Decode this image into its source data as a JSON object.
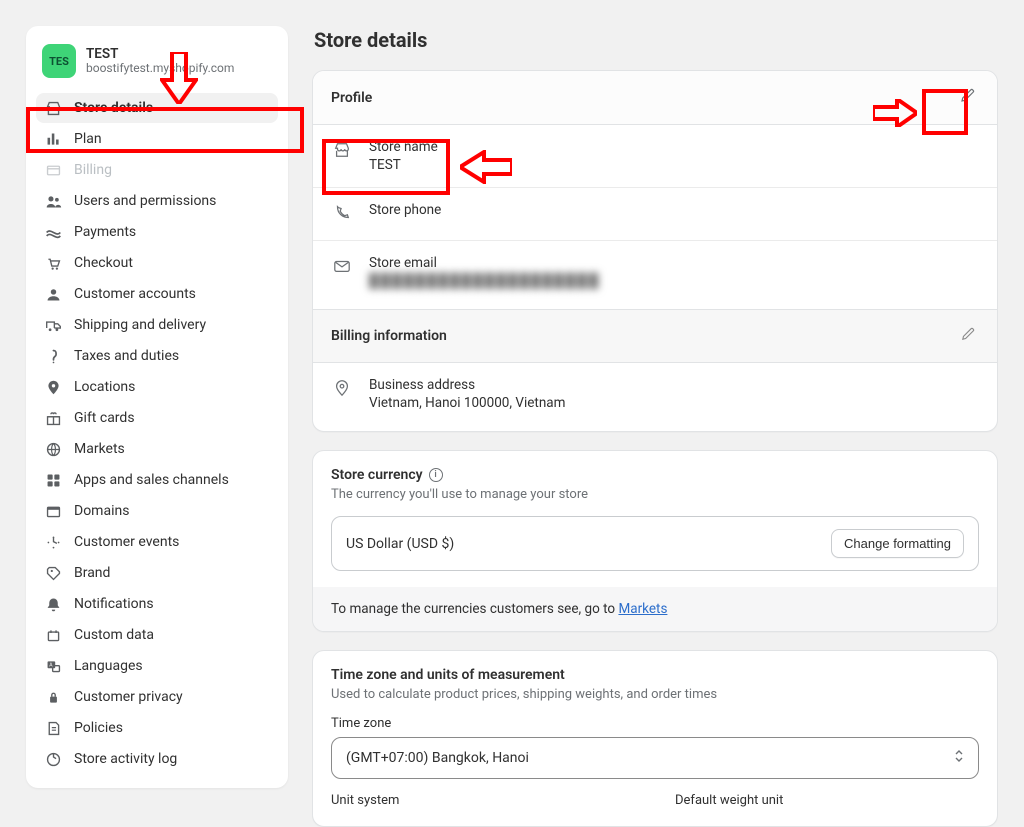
{
  "store": {
    "badge": "TES",
    "name": "TEST",
    "domain": "boostifytest.myshopify.com"
  },
  "nav": [
    {
      "icon": "store",
      "label": "Store details",
      "active": true
    },
    {
      "icon": "plan",
      "label": "Plan"
    },
    {
      "icon": "billing",
      "label": "Billing",
      "disabled": true
    },
    {
      "icon": "users",
      "label": "Users and permissions"
    },
    {
      "icon": "payments",
      "label": "Payments"
    },
    {
      "icon": "checkout",
      "label": "Checkout"
    },
    {
      "icon": "customer",
      "label": "Customer accounts"
    },
    {
      "icon": "shipping",
      "label": "Shipping and delivery"
    },
    {
      "icon": "taxes",
      "label": "Taxes and duties"
    },
    {
      "icon": "locations",
      "label": "Locations"
    },
    {
      "icon": "gift",
      "label": "Gift cards"
    },
    {
      "icon": "markets",
      "label": "Markets"
    },
    {
      "icon": "apps",
      "label": "Apps and sales channels"
    },
    {
      "icon": "domains",
      "label": "Domains"
    },
    {
      "icon": "events",
      "label": "Customer events"
    },
    {
      "icon": "brand",
      "label": "Brand"
    },
    {
      "icon": "notifications",
      "label": "Notifications"
    },
    {
      "icon": "custom",
      "label": "Custom data"
    },
    {
      "icon": "languages",
      "label": "Languages"
    },
    {
      "icon": "privacy",
      "label": "Customer privacy"
    },
    {
      "icon": "policies",
      "label": "Policies"
    },
    {
      "icon": "activity",
      "label": "Store activity log"
    }
  ],
  "page_title": "Store details",
  "profile": {
    "header": "Profile",
    "store_name_label": "Store name",
    "store_name_value": "TEST",
    "phone_label": "Store phone",
    "email_label": "Store email",
    "email_value": "████████████████████"
  },
  "billing": {
    "header": "Billing information",
    "address_label": "Business address",
    "address_value": "Vietnam, Hanoi 100000, Vietnam"
  },
  "currency": {
    "title": "Store currency",
    "subtitle": "The currency you'll use to manage your store",
    "value": "US Dollar (USD $)",
    "button": "Change formatting",
    "note_prefix": "To manage the currencies customers see, go to ",
    "note_link": "Markets"
  },
  "timezone": {
    "title": "Time zone and units of measurement",
    "subtitle": "Used to calculate product prices, shipping weights, and order times",
    "tz_label": "Time zone",
    "tz_value": "(GMT+07:00) Bangkok, Hanoi",
    "unit_system_label": "Unit system",
    "weight_unit_label": "Default weight unit"
  },
  "colors": {
    "accent": "#f00",
    "link": "#2c6ecb",
    "badge_bg": "#3ed477"
  }
}
